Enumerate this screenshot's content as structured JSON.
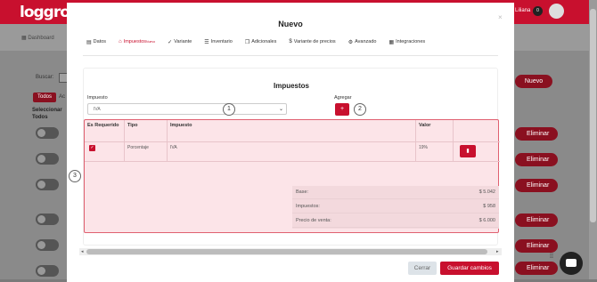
{
  "app": {
    "logo": "loggro",
    "user_name": "Liliana",
    "notification_count": "0",
    "dashboard_label": "Dashboard",
    "search_label": "Buscar:",
    "filter_all": "Todos",
    "filter_other": "Ac",
    "select_all": "Seleccionar Todos",
    "new_button": "Nuevo",
    "delete_label": "Eliminar",
    "brand_color": "#c8102e"
  },
  "modal": {
    "title": "Nuevo",
    "close": "×",
    "tabs": [
      {
        "label": "Datos",
        "icon": "file-icon",
        "glyph": "▤"
      },
      {
        "label": "Impuestos",
        "icon": "bank-icon",
        "glyph": "⌂",
        "badge": "Nuevo",
        "active": true
      },
      {
        "label": "Variante",
        "icon": "check-icon",
        "glyph": "✓"
      },
      {
        "label": "Inventario",
        "icon": "list-icon",
        "glyph": "☰"
      },
      {
        "label": "Adicionales",
        "icon": "copy-icon",
        "glyph": "❐"
      },
      {
        "label": "Variante de precios",
        "icon": "dollar-icon",
        "glyph": "$"
      },
      {
        "label": "Avanzado",
        "icon": "gear-icon",
        "glyph": "⚙"
      },
      {
        "label": "Integraciones",
        "icon": "grid-icon",
        "glyph": "▦"
      }
    ],
    "section_title": "Impuestos",
    "tax_label": "Impuesto",
    "tax_select_value": "IVA",
    "add_label": "Agregar",
    "add_button": "+",
    "markers": [
      "1",
      "2",
      "3"
    ],
    "table": {
      "headers": [
        "Es Requerido",
        "Tipo",
        "Impuesto",
        "Valor"
      ],
      "rows": [
        {
          "required": true,
          "tipo": "Porcentaje",
          "impuesto": "IVA",
          "valor": "19%"
        }
      ]
    },
    "summary": [
      {
        "label": "Base:",
        "value": "$ 5.042"
      },
      {
        "label": "Impuestos:",
        "value": "$ 958"
      },
      {
        "label": "Precio de venta:",
        "value": "$ 6.000"
      }
    ],
    "close_button": "Cerrar",
    "save_button": "Guardar cambios"
  }
}
